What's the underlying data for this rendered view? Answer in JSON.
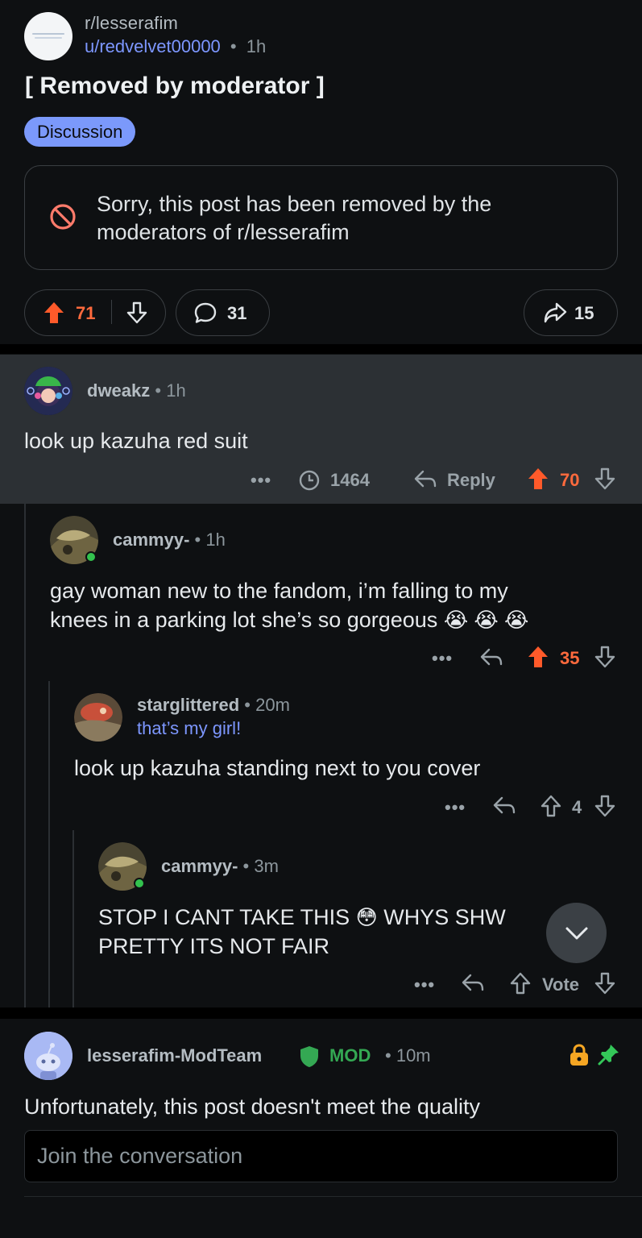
{
  "post": {
    "subreddit": "r/lesserafim",
    "author": "u/redvelvet00000",
    "separator": "•",
    "time": "1h",
    "title": "[ Removed by moderator ]",
    "flair": "Discussion",
    "removed_line1": "Sorry, this post has been removed by the",
    "removed_line2": "moderators of r/lesserafim",
    "upvotes": "71",
    "comments": "31",
    "shares": "15"
  },
  "comments": [
    {
      "username": "dweakz",
      "time": "1h",
      "text": "look up kazuha red suit",
      "views": "1464",
      "reply_label": "Reply",
      "score": "70",
      "more": "•••"
    },
    {
      "username": "cammyy-",
      "time": "1h",
      "line1": "gay woman new to the fandom, i’m falling to my",
      "line2": "knees in a parking lot she’s so gorgeous",
      "emoji": "😭 😭 😭",
      "score": "35",
      "more": "•••"
    },
    {
      "username": "starglittered",
      "time": "20m",
      "user_flair": "that’s my girl!",
      "text": "look up kazuha standing next to you cover",
      "score": "4",
      "more": "•••"
    },
    {
      "username": "cammyy-",
      "time": "3m",
      "line1_a": "STOP I CANT TAKE THIS",
      "emoji": "😳",
      "line1_b": "WHYS SHW",
      "line2": "PRETTY ITS NOT FAIR",
      "vote_label": "Vote",
      "more": "•••"
    }
  ],
  "mod_comment": {
    "username": "lesserafim-ModTeam",
    "badge": "MOD",
    "time": "10m",
    "text": "Unfortunately, this post doesn't meet the quality"
  },
  "composer": {
    "placeholder": "Join the conversation"
  },
  "icons": {
    "upvote_filled": "upvote-arrow-icon",
    "downvote": "downvote-arrow-icon",
    "comment": "comment-bubble-icon",
    "share": "share-arrow-icon",
    "reply": "reply-arrow-icon",
    "views": "clock-icon",
    "removed": "no-entry-icon",
    "lock": "lock-icon",
    "pin": "pin-icon",
    "shield": "mod-shield-icon",
    "scroll": "chevron-down-icon"
  },
  "colors": {
    "background": "#0e1012",
    "highlight": "#2c3034",
    "upvote": "#ff6a3d",
    "flair": "#7b99fb",
    "user_link": "#7d97ff",
    "mod_green": "#34a853",
    "lock": "#f5a623"
  }
}
